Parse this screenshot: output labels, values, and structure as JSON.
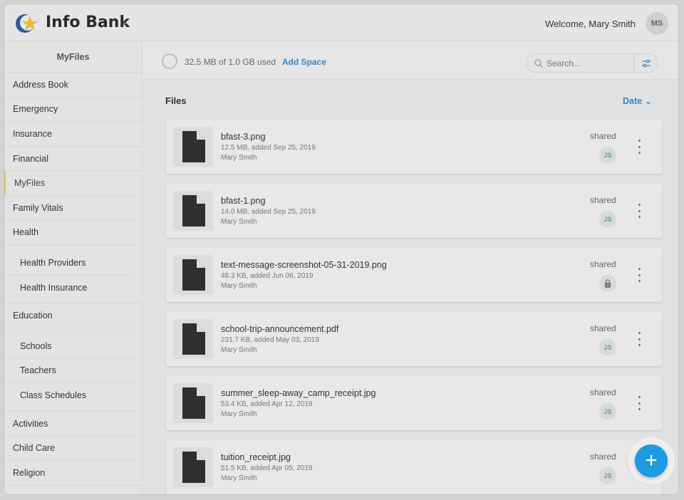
{
  "header": {
    "app_title": "Info Bank",
    "welcome": "Welcome, Mary Smith",
    "avatar_initials": "MS"
  },
  "sidebar": {
    "title": "MyFiles",
    "items_top": [
      "Address Book",
      "Emergency",
      "Insurance",
      "Financial",
      "MyFiles",
      "Family Vitals",
      "Health"
    ],
    "health_sub": [
      "Health Providers",
      "Health Insurance"
    ],
    "education": "Education",
    "education_sub": [
      "Schools",
      "Teachers",
      "Class Schedules"
    ],
    "items_bottom": [
      "Activities",
      "Child Care",
      "Religion"
    ],
    "active_item": "MyFiles"
  },
  "storage": {
    "used_text": "32.5 MB of 1.0 GB used",
    "add_space": "Add Space"
  },
  "search": {
    "placeholder": "Search..."
  },
  "files_section": {
    "title": "Files",
    "sort_label": "Date"
  },
  "files": [
    {
      "name": "bfast-3.png",
      "meta": "12.5 MB, added Sep 25, 2019",
      "owner": "Mary Smith",
      "shared": "shared",
      "share": "JS"
    },
    {
      "name": "bfast-1.png",
      "meta": "14.0 MB, added Sep 25, 2019",
      "owner": "Mary Smith",
      "shared": "shared",
      "share": "JS"
    },
    {
      "name": "text-message-screenshot-05-31-2019.png",
      "meta": "48.3 KB, added Jun 06, 2019",
      "owner": "Mary Smith",
      "shared": "shared",
      "share": "lock"
    },
    {
      "name": "school-trip-announcement.pdf",
      "meta": "231.7 KB, added May 03, 2019",
      "owner": "Mary Smith",
      "shared": "shared",
      "share": "JS"
    },
    {
      "name": "summer_sleep-away_camp_receipt.jpg",
      "meta": "53.4 KB, added Apr 12, 2019",
      "owner": "Mary Smith",
      "shared": "shared",
      "share": "JS"
    },
    {
      "name": "tuition_receipt.jpg",
      "meta": "51.5 KB, added Apr 05, 2019",
      "owner": "Mary Smith",
      "shared": "shared",
      "share": "JS"
    }
  ],
  "fab": {
    "symbol": "+"
  },
  "colors": {
    "accent": "#3a86c4",
    "fab": "#1e9ae0",
    "active_marker": "#e6c35c"
  }
}
